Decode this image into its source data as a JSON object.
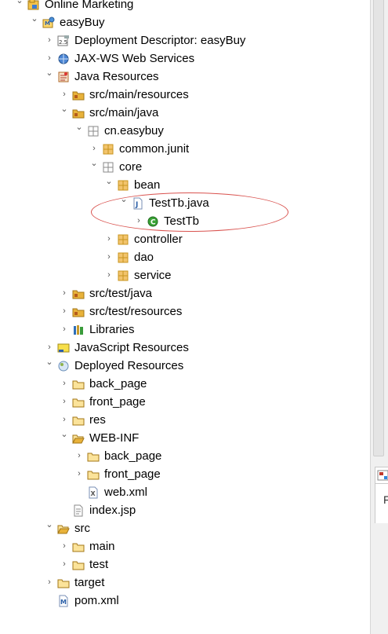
{
  "tree": [
    {
      "label": "Online Marketing",
      "icon": "working-set-icon",
      "expanded": true,
      "depth": 0
    },
    {
      "label": "easyBuy",
      "icon": "web-project-icon",
      "expanded": true,
      "depth": 1
    },
    {
      "label": "Deployment Descriptor: easyBuy",
      "icon": "deployment-descriptor-icon",
      "expanded": false,
      "depth": 2
    },
    {
      "label": "JAX-WS Web Services",
      "icon": "web-services-icon",
      "expanded": false,
      "depth": 2
    },
    {
      "label": "Java Resources",
      "icon": "java-resources-icon",
      "expanded": true,
      "depth": 2
    },
    {
      "label": "src/main/resources",
      "icon": "source-folder-icon",
      "expanded": false,
      "depth": 3
    },
    {
      "label": "src/main/java",
      "icon": "source-folder-icon",
      "expanded": true,
      "depth": 3
    },
    {
      "label": "cn.easybuy",
      "icon": "package-empty-icon",
      "expanded": true,
      "depth": 4
    },
    {
      "label": "common.junit",
      "icon": "package-icon",
      "expanded": false,
      "depth": 5
    },
    {
      "label": "core",
      "icon": "package-empty-icon",
      "expanded": true,
      "depth": 5
    },
    {
      "label": "bean",
      "icon": "package-icon",
      "expanded": true,
      "depth": 6
    },
    {
      "label": "TestTb.java",
      "icon": "java-file-icon",
      "expanded": true,
      "depth": 7
    },
    {
      "label": "TestTb",
      "icon": "class-icon",
      "expanded": false,
      "depth": 8
    },
    {
      "label": "controller",
      "icon": "package-icon",
      "expanded": false,
      "depth": 6
    },
    {
      "label": "dao",
      "icon": "package-icon",
      "expanded": false,
      "depth": 6
    },
    {
      "label": "service",
      "icon": "package-icon",
      "expanded": false,
      "depth": 6
    },
    {
      "label": "src/test/java",
      "icon": "source-folder-icon",
      "expanded": false,
      "depth": 3
    },
    {
      "label": "src/test/resources",
      "icon": "source-folder-icon",
      "expanded": false,
      "depth": 3
    },
    {
      "label": "Libraries",
      "icon": "libraries-icon",
      "expanded": false,
      "depth": 3
    },
    {
      "label": "JavaScript Resources",
      "icon": "javascript-resources-icon",
      "expanded": false,
      "depth": 2
    },
    {
      "label": "Deployed Resources",
      "icon": "deployed-resources-icon",
      "expanded": true,
      "depth": 2
    },
    {
      "label": "back_page",
      "icon": "folder-icon",
      "expanded": false,
      "depth": 3
    },
    {
      "label": "front_page",
      "icon": "folder-icon",
      "expanded": false,
      "depth": 3
    },
    {
      "label": "res",
      "icon": "folder-icon",
      "expanded": false,
      "depth": 3
    },
    {
      "label": "WEB-INF",
      "icon": "folder-open-icon",
      "expanded": true,
      "depth": 3
    },
    {
      "label": "back_page",
      "icon": "folder-icon",
      "expanded": false,
      "depth": 4
    },
    {
      "label": "front_page",
      "icon": "folder-icon",
      "expanded": false,
      "depth": 4
    },
    {
      "label": "web.xml",
      "icon": "xml-file-icon",
      "expanded": null,
      "depth": 4
    },
    {
      "label": "index.jsp",
      "icon": "jsp-file-icon",
      "expanded": null,
      "depth": 3
    },
    {
      "label": "src",
      "icon": "folder-open-icon",
      "expanded": true,
      "depth": 2
    },
    {
      "label": "main",
      "icon": "folder-icon",
      "expanded": false,
      "depth": 3
    },
    {
      "label": "test",
      "icon": "folder-icon",
      "expanded": false,
      "depth": 3
    },
    {
      "label": "target",
      "icon": "folder-icon",
      "expanded": false,
      "depth": 2
    },
    {
      "label": "pom.xml",
      "icon": "maven-pom-icon",
      "expanded": null,
      "depth": 2
    }
  ],
  "right_panel": {
    "tab_icon": "view-tab-icon",
    "text": "F"
  },
  "colors": {
    "annotation": "#d9534f",
    "folder": "#e8b23a",
    "package": "#c8941e",
    "class": "#3aa336"
  }
}
